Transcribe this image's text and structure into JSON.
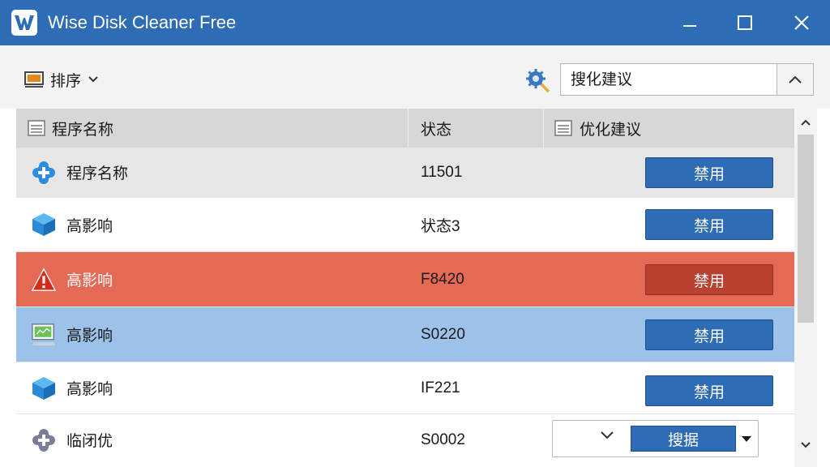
{
  "window": {
    "title": "Wise Disk Cleaner Free",
    "accent": "#2e6db5"
  },
  "toolbar": {
    "sort_label": "排序",
    "search_value": "搜化建议"
  },
  "table": {
    "headers": [
      "程序名称",
      "状态",
      "优化建议"
    ],
    "rows": [
      {
        "name": "程序名称",
        "status": "11501",
        "action": "禁用",
        "icon": "plus-puzzle-icon",
        "bg": "#e6e6e6"
      },
      {
        "name": "高影响",
        "status": "状态3",
        "action": "禁用",
        "icon": "cube-icon",
        "bg": "#ffffff"
      },
      {
        "name": "高影响",
        "status": "F8420",
        "action": "禁用",
        "icon": "warning-icon",
        "bg": "#e56a56"
      },
      {
        "name": "高影响",
        "status": "S0220",
        "action": "禁用",
        "icon": "monitor-icon",
        "bg": "#9cc2ea"
      },
      {
        "name": "高影响",
        "status": "IF221",
        "action": "禁用",
        "icon": "cube-icon",
        "bg": "#ffffff"
      },
      {
        "name": "临闭优",
        "status": "S0002",
        "action": "搜据",
        "icon": "gear-plus-icon",
        "bg": "#ffffff"
      }
    ]
  }
}
